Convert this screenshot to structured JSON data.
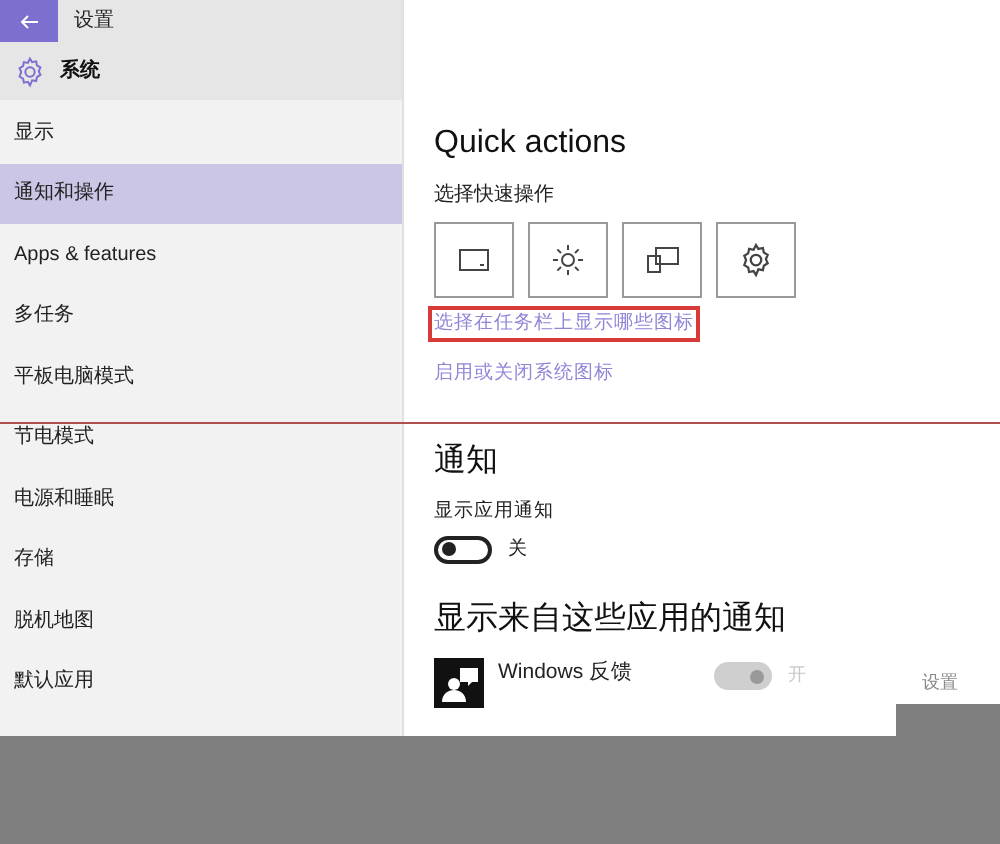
{
  "title_bar": {
    "title": "设置"
  },
  "header": {
    "title": "系统"
  },
  "sidebar": {
    "items": [
      {
        "label": "显示",
        "selected": false
      },
      {
        "label": "通知和操作",
        "selected": true
      },
      {
        "label": "Apps & features",
        "selected": false
      },
      {
        "label": "多任务",
        "selected": false
      },
      {
        "label": "平板电脑模式",
        "selected": false
      },
      {
        "label": "节电模式",
        "selected": false
      },
      {
        "label": "电源和睡眠",
        "selected": false
      },
      {
        "label": "存储",
        "selected": false
      },
      {
        "label": "脱机地图",
        "selected": false
      },
      {
        "label": "默认应用",
        "selected": false
      }
    ]
  },
  "quick_actions": {
    "title": "Quick actions",
    "subtitle": "选择快速操作",
    "tiles": [
      {
        "kind": "tablet"
      },
      {
        "kind": "brightness"
      },
      {
        "kind": "project"
      },
      {
        "kind": "settings"
      }
    ],
    "links": [
      {
        "label": "选择在任务栏上显示哪些图标",
        "highlighted": true
      },
      {
        "label": "启用或关闭系统图标",
        "highlighted": false
      }
    ]
  },
  "notifications": {
    "title": "通知",
    "label": "显示应用通知",
    "toggle": {
      "on": false,
      "label": "关"
    }
  },
  "apps_section": {
    "title": "显示来自这些应用的通知",
    "apps": [
      {
        "name": "Windows 反馈",
        "on": true,
        "disabled": true,
        "state_label": "开",
        "settings": "设置"
      }
    ]
  }
}
